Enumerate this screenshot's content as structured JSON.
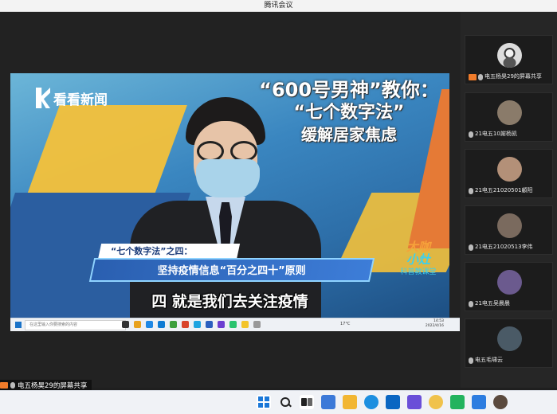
{
  "window": {
    "title": "腾讯会议"
  },
  "video": {
    "logo_text": "看看新闻",
    "headline": [
      "“600号男神”教你：",
      "“七个数字法”",
      "缓解居家焦虑"
    ],
    "caption_top": "“七个数字法”之四：",
    "caption_main": "坚持疫情信息“百分之四十”原则",
    "brand": [
      "大咖",
      "小灶",
      "科普教课堂"
    ],
    "subtitle": "四 就是我们去关注疫情"
  },
  "shared_taskbar": {
    "search_placeholder": "在这里输入你要搜索的内容",
    "temperature": "17°C",
    "time": "14:53",
    "date": "2022/4/16"
  },
  "participants": [
    {
      "name": "电五杨昊29的屏幕共享",
      "sharing": true,
      "color": "#d8d8d8"
    },
    {
      "name": "21电五10謝杨凯",
      "sharing": false,
      "color": "#8a7b6a"
    },
    {
      "name": "21电五21020501顧阳",
      "sharing": false,
      "color": "#b39078"
    },
    {
      "name": "21电五21020513李伟",
      "sharing": false,
      "color": "#7a6a5e"
    },
    {
      "name": "21电五吴晨晨",
      "sharing": false,
      "color": "#6b5a8e"
    },
    {
      "name": "电五毛啸云",
      "sharing": false,
      "color": "#4a5a66"
    }
  ],
  "share_label": "电五杨昊29的屏幕共享",
  "os_taskbar_icons": [
    "windows-start-icon",
    "search-icon",
    "task-view-icon",
    "widgets-icon",
    "file-explorer-icon",
    "edge-browser-icon",
    "mail-icon",
    "photos-icon",
    "wechat-icon",
    "media-player-icon",
    "store-icon",
    "tencent-meeting-icon"
  ]
}
